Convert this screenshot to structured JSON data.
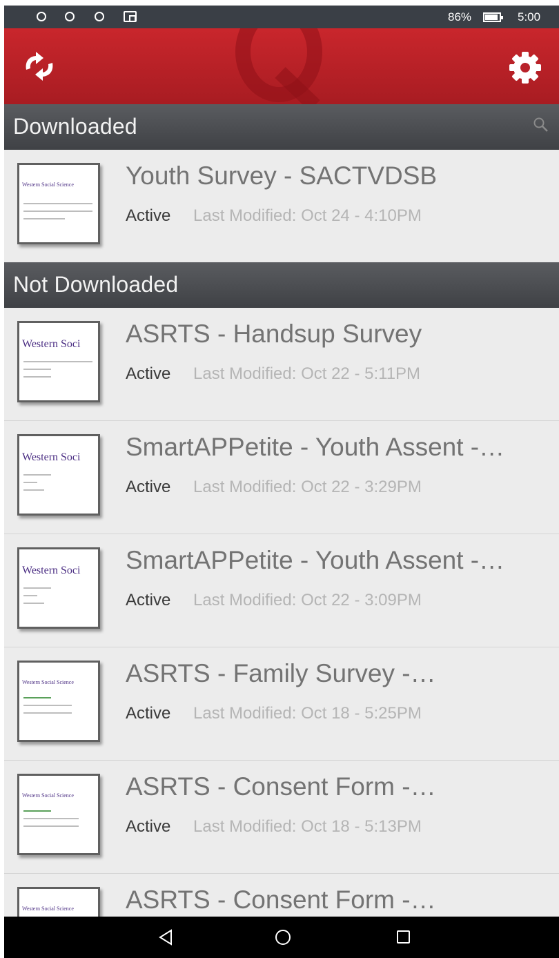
{
  "status_bar": {
    "battery": "86%",
    "time": "5:00"
  },
  "colors": {
    "header_red": "#b8222a",
    "section_gray": "#4d4f53",
    "list_bg": "#ececec"
  },
  "header": {
    "sync_icon": "sync-arrows-icon",
    "settings_icon": "gear-icon",
    "logo_icon": "q-logo-icon"
  },
  "sections": {
    "downloaded": {
      "title": "Downloaded",
      "items": [
        {
          "title": "Youth Survey - SACTVDSB",
          "status": "Active",
          "modified": "Last Modified: Oct 24 - 4:10PM",
          "thumb_brand": "Western Social Science"
        }
      ]
    },
    "not_downloaded": {
      "title": "Not Downloaded",
      "items": [
        {
          "title": "ASRTS - Handsup Survey",
          "status": "Active",
          "modified": "Last Modified: Oct 22 - 5:11PM",
          "thumb_brand": "Western Soci"
        },
        {
          "title": "SmartAPPetite - Youth Assent -…",
          "status": "Active",
          "modified": "Last Modified: Oct 22 - 3:29PM",
          "thumb_brand": "Western Soci"
        },
        {
          "title": "SmartAPPetite - Youth Assent -…",
          "status": "Active",
          "modified": "Last Modified: Oct 22 - 3:09PM",
          "thumb_brand": "Western Soci"
        },
        {
          "title": "ASRTS - Family Survey -…",
          "status": "Active",
          "modified": "Last Modified: Oct 18 - 5:25PM",
          "thumb_brand": "Western Social Science"
        },
        {
          "title": "ASRTS - Consent Form -…",
          "status": "Active",
          "modified": "Last Modified: Oct 18 - 5:13PM",
          "thumb_brand": "Western Social Science"
        },
        {
          "title": "ASRTS - Consent Form -…",
          "status": "",
          "modified": "",
          "thumb_brand": "Western Social Science"
        }
      ]
    }
  },
  "nav_bar": {
    "back_icon": "back-triangle-icon",
    "home_icon": "home-circle-icon",
    "recent_icon": "recent-square-icon"
  }
}
